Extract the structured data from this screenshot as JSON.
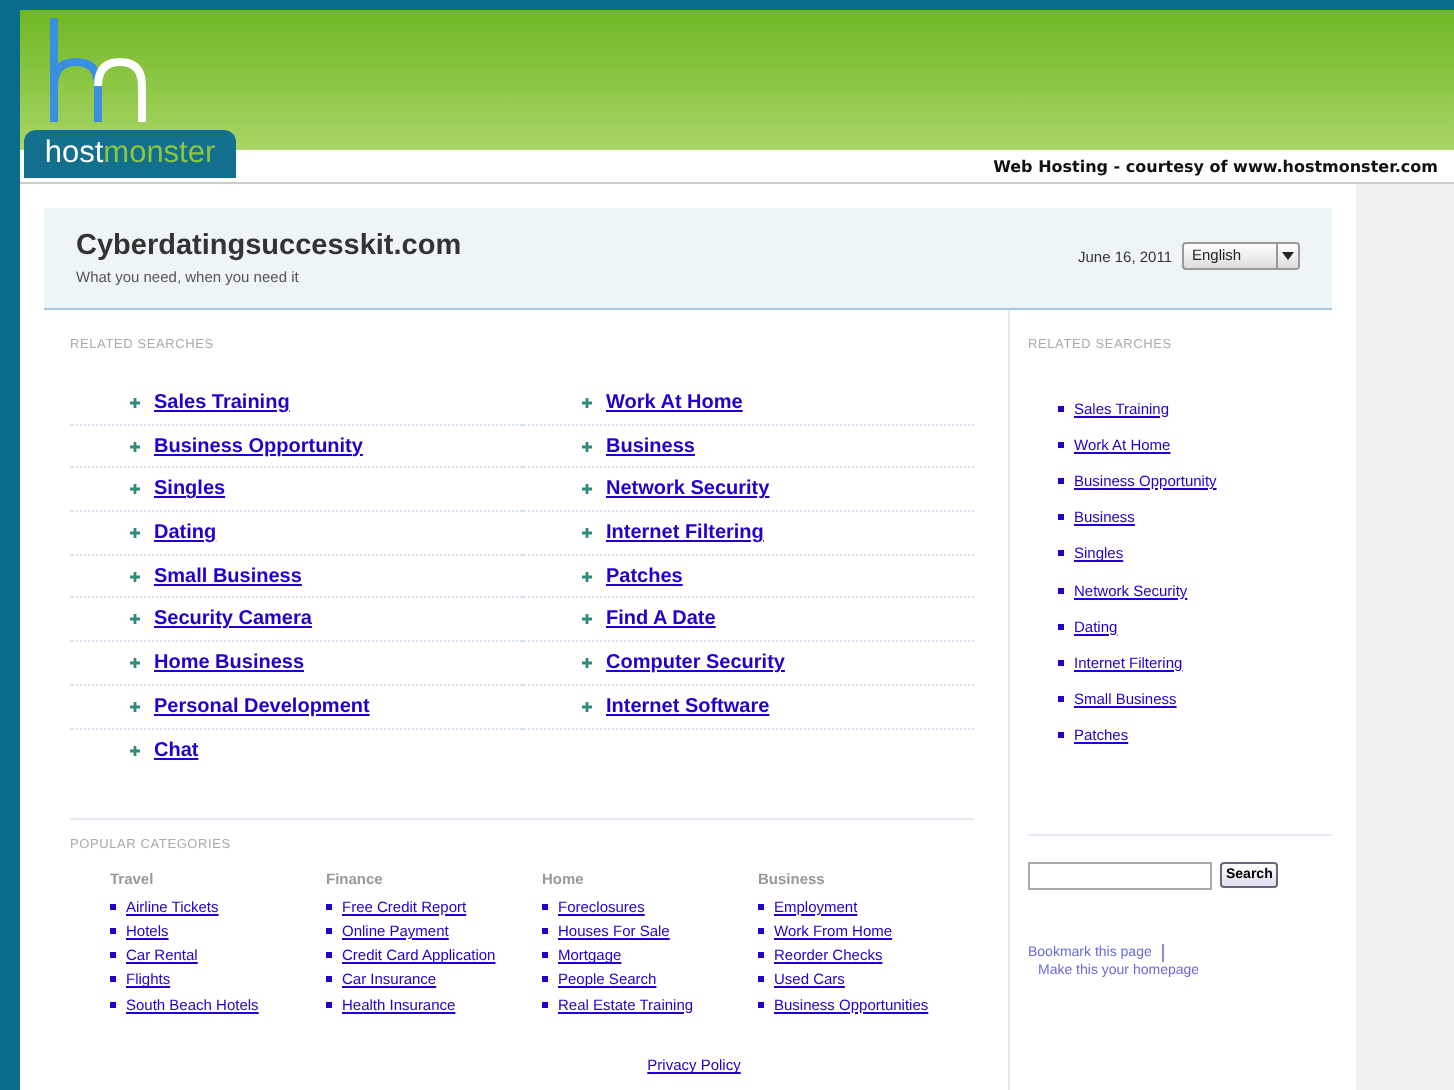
{
  "header": {
    "logo_host": "host",
    "logo_monster": "monster",
    "courtesy": "Web Hosting - courtesy of www.hostmonster.com"
  },
  "site": {
    "title": "Cyberdatingsuccesskit.com",
    "tagline": "What you need, when you need it",
    "date": "June 16, 2011",
    "language": "English"
  },
  "related_searches": {
    "heading": "RELATED SEARCHES",
    "items": [
      "Sales Training",
      "Work At Home",
      "Business Opportunity",
      "Business",
      "Singles",
      "Network Security",
      "Dating",
      "Internet Filtering",
      "Small Business",
      "Patches",
      "Security Camera",
      "Find A Date",
      "Home Business",
      "Computer Security",
      "Personal Development",
      "Internet Software",
      "Chat"
    ]
  },
  "popular_categories": {
    "heading": "POPULAR CATEGORIES",
    "groups": [
      {
        "title": "Travel",
        "links": [
          "Airline Tickets",
          "Hotels",
          "Car Rental",
          "Flights",
          "South Beach Hotels"
        ]
      },
      {
        "title": "Finance",
        "links": [
          "Free Credit Report",
          "Online Payment",
          "Credit Card Application",
          "Car Insurance",
          "Health Insurance"
        ]
      },
      {
        "title": "Home",
        "links": [
          "Foreclosures",
          "Houses For Sale",
          "Mortgage",
          "People Search",
          "Real Estate Training"
        ]
      },
      {
        "title": "Business",
        "links": [
          "Employment",
          "Work From Home",
          "Reorder Checks",
          "Used Cars",
          "Business Opportunities"
        ]
      }
    ]
  },
  "sidebar": {
    "heading": "RELATED SEARCHES",
    "links": [
      "Sales Training",
      "Work At Home",
      "Business Opportunity",
      "Business",
      "Singles",
      "Network Security",
      "Dating",
      "Internet Filtering",
      "Small Business",
      "Patches"
    ],
    "search_button": "Search",
    "bookmark": "Bookmark this page",
    "homepage": "Make this your homepage"
  },
  "footer": {
    "privacy": "Privacy Policy"
  }
}
